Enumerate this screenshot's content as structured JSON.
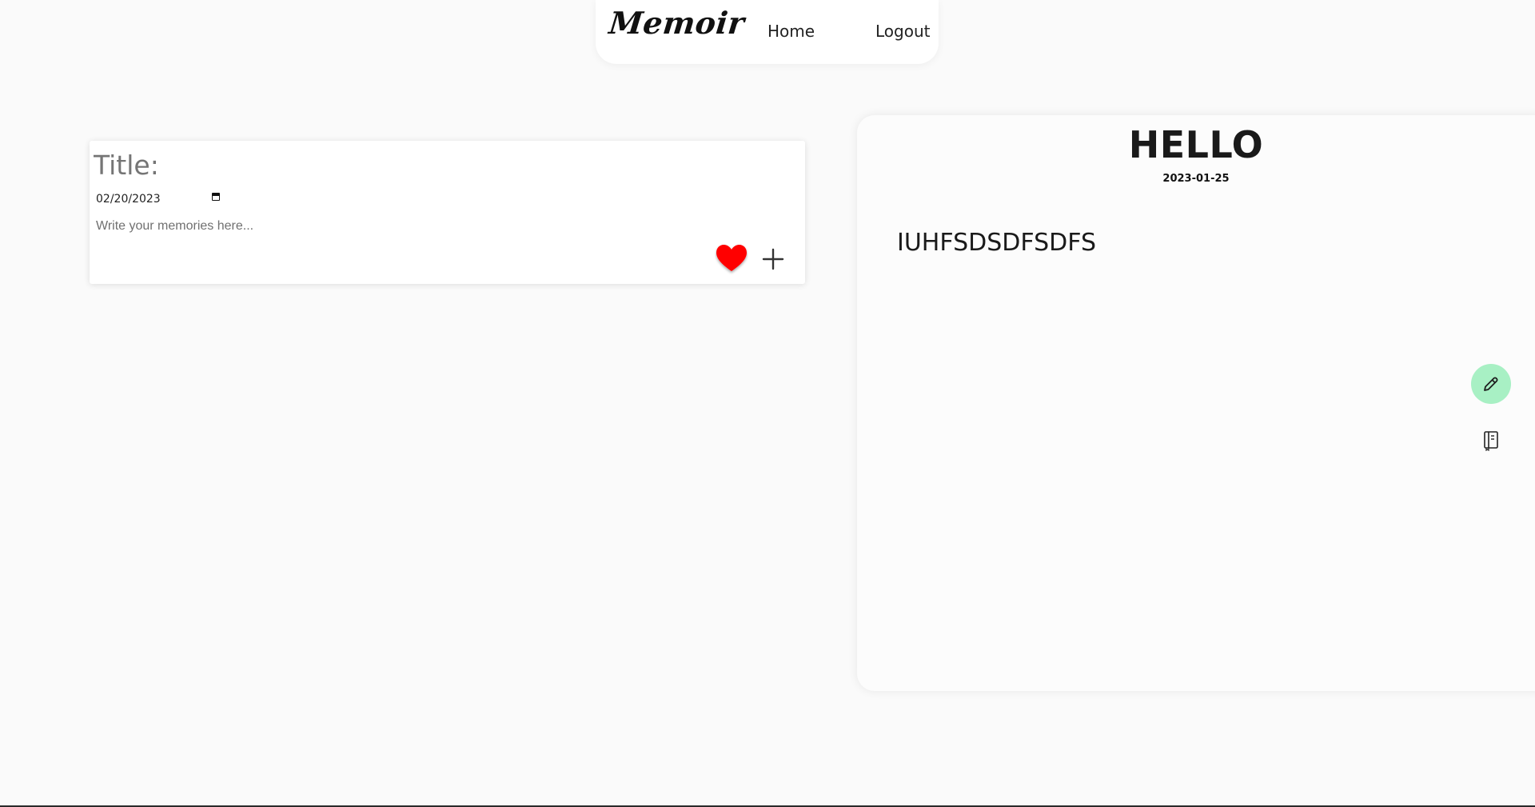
{
  "nav": {
    "brand": "Memoir",
    "home_label": "Home",
    "logout_label": "Logout"
  },
  "compose": {
    "title_placeholder": "Title:",
    "date_value": "02/20/2023",
    "memory_placeholder": "Write your memories here...",
    "heart_icon": "heart-icon",
    "add_icon": "plus-icon",
    "heart_color": "#ff0000"
  },
  "memory": {
    "title": "HELLO",
    "date": "2023-01-25",
    "body": "IUHFSDSDFSDFS",
    "edit_icon": "pencil-icon",
    "edit_button_color": "#a8f0c4",
    "journal_icon": "journal-icon"
  }
}
